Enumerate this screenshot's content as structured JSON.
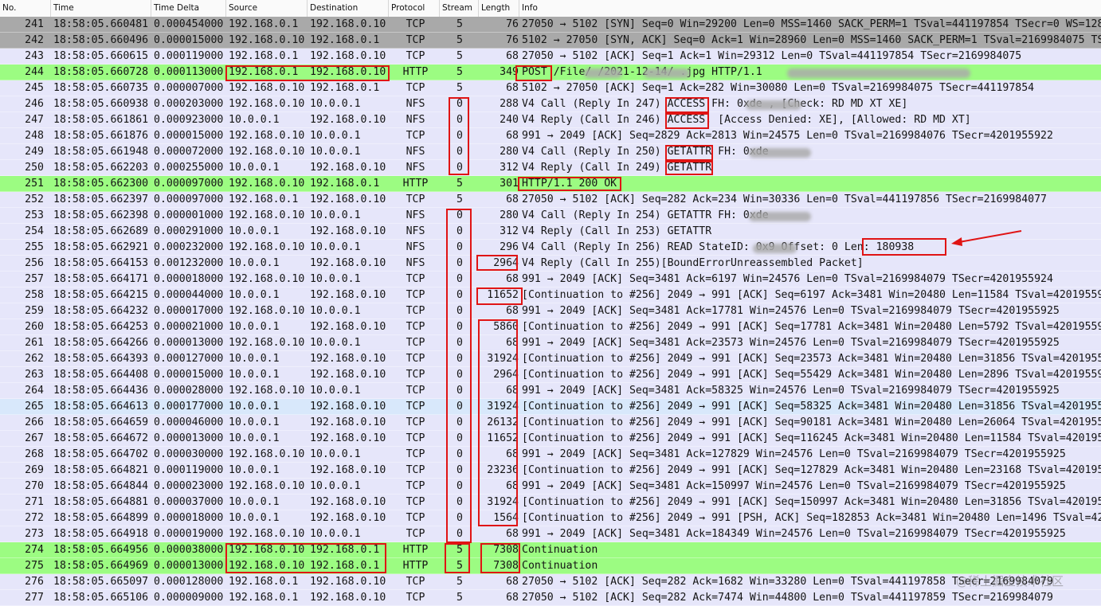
{
  "columns": {
    "no": "No.",
    "time": "Time",
    "delta": "Time Delta",
    "src": "Source",
    "dst": "Destination",
    "proto": "Protocol",
    "stream": "Stream",
    "len": "Length",
    "info": "Info"
  },
  "colors": {
    "dark": "#a9a9a9",
    "tcp": "#e6e6fa",
    "http": "#9cfc82",
    "selected": "#d8e8fb",
    "annotation": "#e01414"
  },
  "rows": [
    {
      "no": "241",
      "time": "18:58:05.660481",
      "delta": "0.000454000",
      "src": "192.168.0.1",
      "dst": "192.168.0.10",
      "proto": "TCP",
      "stream": "5",
      "len": "76",
      "info": "27050 → 5102 [SYN] Seq=0 Win=29200 Len=0 MSS=1460 SACK_PERM=1 TSval=441197854 TSecr=0 WS=128",
      "kind": "dark"
    },
    {
      "no": "242",
      "time": "18:58:05.660496",
      "delta": "0.000015000",
      "src": "192.168.0.10",
      "dst": "192.168.0.1",
      "proto": "TCP",
      "stream": "5",
      "len": "76",
      "info": "5102 → 27050 [SYN, ACK] Seq=0 Ack=1 Win=28960 Len=0 MSS=1460 SACK_PERM=1 TSval=2169984075 TSecr=441197854",
      "kind": "dark"
    },
    {
      "no": "243",
      "time": "18:58:05.660615",
      "delta": "0.000119000",
      "src": "192.168.0.1",
      "dst": "192.168.0.10",
      "proto": "TCP",
      "stream": "5",
      "len": "68",
      "info": "27050 → 5102 [ACK] Seq=1 Ack=1 Win=29312 Len=0 TSval=441197854 TSecr=2169984075",
      "kind": "tcp"
    },
    {
      "no": "244",
      "time": "18:58:05.660728",
      "delta": "0.000113000",
      "src": "192.168.0.1",
      "dst": "192.168.0.10",
      "proto": "HTTP",
      "stream": "5",
      "len": "349",
      "info": "POST /File/          /2021-12-14/                          .jpg HTTP/1.1",
      "kind": "http"
    },
    {
      "no": "245",
      "time": "18:58:05.660735",
      "delta": "0.000007000",
      "src": "192.168.0.10",
      "dst": "192.168.0.1",
      "proto": "TCP",
      "stream": "5",
      "len": "68",
      "info": "5102 → 27050 [ACK] Seq=1 Ack=282 Win=30080 Len=0 TSval=2169984075 TSecr=441197854",
      "kind": "tcp"
    },
    {
      "no": "246",
      "time": "18:58:05.660938",
      "delta": "0.000203000",
      "src": "192.168.0.10",
      "dst": "10.0.0.1",
      "proto": "NFS",
      "stream": "0",
      "len": "288",
      "info": "V4 Call (Reply In 247) ACCESS FH: 0xde       , [Check: RD MD XT XE]",
      "kind": "tcp"
    },
    {
      "no": "247",
      "time": "18:58:05.661861",
      "delta": "0.000923000",
      "src": "10.0.0.1",
      "dst": "192.168.0.10",
      "proto": "NFS",
      "stream": "0",
      "len": "240",
      "info": "V4 Reply (Call In 246) ACCESS, [Access Denied: XE], [Allowed: RD MD XT]",
      "kind": "tcp"
    },
    {
      "no": "248",
      "time": "18:58:05.661876",
      "delta": "0.000015000",
      "src": "192.168.0.10",
      "dst": "10.0.0.1",
      "proto": "TCP",
      "stream": "0",
      "len": "68",
      "info": "991 → 2049 [ACK] Seq=2829 Ack=2813 Win=24575 Len=0 TSval=2169984076 TSecr=4201955922",
      "kind": "tcp"
    },
    {
      "no": "249",
      "time": "18:58:05.661948",
      "delta": "0.000072000",
      "src": "192.168.0.10",
      "dst": "10.0.0.1",
      "proto": "NFS",
      "stream": "0",
      "len": "280",
      "info": "V4 Call (Reply In 250) GETATTR FH: 0xde",
      "kind": "tcp"
    },
    {
      "no": "250",
      "time": "18:58:05.662203",
      "delta": "0.000255000",
      "src": "10.0.0.1",
      "dst": "192.168.0.10",
      "proto": "NFS",
      "stream": "0",
      "len": "312",
      "info": "V4 Reply (Call In 249) GETATTR",
      "kind": "tcp"
    },
    {
      "no": "251",
      "time": "18:58:05.662300",
      "delta": "0.000097000",
      "src": "192.168.0.10",
      "dst": "192.168.0.1",
      "proto": "HTTP",
      "stream": "5",
      "len": "301",
      "info": "HTTP/1.1 200 OK",
      "kind": "http"
    },
    {
      "no": "252",
      "time": "18:58:05.662397",
      "delta": "0.000097000",
      "src": "192.168.0.1",
      "dst": "192.168.0.10",
      "proto": "TCP",
      "stream": "5",
      "len": "68",
      "info": "27050 → 5102 [ACK] Seq=282 Ack=234 Win=30336 Len=0 TSval=441197856 TSecr=2169984077",
      "kind": "tcp"
    },
    {
      "no": "253",
      "time": "18:58:05.662398",
      "delta": "0.000001000",
      "src": "192.168.0.10",
      "dst": "10.0.0.1",
      "proto": "NFS",
      "stream": "0",
      "len": "280",
      "info": "V4 Call (Reply In 254) GETATTR FH: 0xde",
      "kind": "tcp"
    },
    {
      "no": "254",
      "time": "18:58:05.662689",
      "delta": "0.000291000",
      "src": "10.0.0.1",
      "dst": "192.168.0.10",
      "proto": "NFS",
      "stream": "0",
      "len": "312",
      "info": "V4 Reply (Call In 253) GETATTR",
      "kind": "tcp"
    },
    {
      "no": "255",
      "time": "18:58:05.662921",
      "delta": "0.000232000",
      "src": "192.168.0.10",
      "dst": "10.0.0.1",
      "proto": "NFS",
      "stream": "0",
      "len": "296",
      "info": "V4 Call (Reply In 256) READ StateID: 0x9     Offset: 0 Len: 180938",
      "kind": "tcp"
    },
    {
      "no": "256",
      "time": "18:58:05.664153",
      "delta": "0.001232000",
      "src": "10.0.0.1",
      "dst": "192.168.0.10",
      "proto": "NFS",
      "stream": "0",
      "len": "2964",
      "info": "V4 Reply (Call In 255)[BoundErrorUnreassembled Packet]",
      "kind": "tcp"
    },
    {
      "no": "257",
      "time": "18:58:05.664171",
      "delta": "0.000018000",
      "src": "192.168.0.10",
      "dst": "10.0.0.1",
      "proto": "TCP",
      "stream": "0",
      "len": "68",
      "info": "991 → 2049 [ACK] Seq=3481 Ack=6197 Win=24576 Len=0 TSval=2169984079 TSecr=4201955924",
      "kind": "tcp"
    },
    {
      "no": "258",
      "time": "18:58:05.664215",
      "delta": "0.000044000",
      "src": "10.0.0.1",
      "dst": "192.168.0.10",
      "proto": "TCP",
      "stream": "0",
      "len": "11652",
      "info": "[Continuation to #256] 2049 → 991 [ACK] Seq=6197 Ack=3481 Win=20480 Len=11584 TSval=4201955924",
      "kind": "tcp"
    },
    {
      "no": "259",
      "time": "18:58:05.664232",
      "delta": "0.000017000",
      "src": "192.168.0.10",
      "dst": "10.0.0.1",
      "proto": "TCP",
      "stream": "0",
      "len": "68",
      "info": "991 → 2049 [ACK] Seq=3481 Ack=17781 Win=24576 Len=0 TSval=2169984079 TSecr=4201955925",
      "kind": "tcp"
    },
    {
      "no": "260",
      "time": "18:58:05.664253",
      "delta": "0.000021000",
      "src": "10.0.0.1",
      "dst": "192.168.0.10",
      "proto": "TCP",
      "stream": "0",
      "len": "5860",
      "info": "[Continuation to #256] 2049 → 991 [ACK] Seq=17781 Ack=3481 Win=20480 Len=5792 TSval=4201955925",
      "kind": "tcp"
    },
    {
      "no": "261",
      "time": "18:58:05.664266",
      "delta": "0.000013000",
      "src": "192.168.0.10",
      "dst": "10.0.0.1",
      "proto": "TCP",
      "stream": "0",
      "len": "68",
      "info": "991 → 2049 [ACK] Seq=3481 Ack=23573 Win=24576 Len=0 TSval=2169984079 TSecr=4201955925",
      "kind": "tcp"
    },
    {
      "no": "262",
      "time": "18:58:05.664393",
      "delta": "0.000127000",
      "src": "10.0.0.1",
      "dst": "192.168.0.10",
      "proto": "TCP",
      "stream": "0",
      "len": "31924",
      "info": "[Continuation to #256] 2049 → 991 [ACK] Seq=23573 Ack=3481 Win=20480 Len=31856 TSval=4201955925",
      "kind": "tcp"
    },
    {
      "no": "263",
      "time": "18:58:05.664408",
      "delta": "0.000015000",
      "src": "10.0.0.1",
      "dst": "192.168.0.10",
      "proto": "TCP",
      "stream": "0",
      "len": "2964",
      "info": "[Continuation to #256] 2049 → 991 [ACK] Seq=55429 Ack=3481 Win=20480 Len=2896 TSval=4201955925",
      "kind": "tcp"
    },
    {
      "no": "264",
      "time": "18:58:05.664436",
      "delta": "0.000028000",
      "src": "192.168.0.10",
      "dst": "10.0.0.1",
      "proto": "TCP",
      "stream": "0",
      "len": "68",
      "info": "991 → 2049 [ACK] Seq=3481 Ack=58325 Win=24576 Len=0 TSval=2169984079 TSecr=4201955925",
      "kind": "tcp"
    },
    {
      "no": "265",
      "time": "18:58:05.664613",
      "delta": "0.000177000",
      "src": "10.0.0.1",
      "dst": "192.168.0.10",
      "proto": "TCP",
      "stream": "0",
      "len": "31924",
      "info": "[Continuation to #256] 2049 → 991 [ACK] Seq=58325 Ack=3481 Win=20480 Len=31856 TSval=4201955925",
      "kind": "selected"
    },
    {
      "no": "266",
      "time": "18:58:05.664659",
      "delta": "0.000046000",
      "src": "10.0.0.1",
      "dst": "192.168.0.10",
      "proto": "TCP",
      "stream": "0",
      "len": "26132",
      "info": "[Continuation to #256] 2049 → 991 [ACK] Seq=90181 Ack=3481 Win=20480 Len=26064 TSval=4201955925",
      "kind": "tcp"
    },
    {
      "no": "267",
      "time": "18:58:05.664672",
      "delta": "0.000013000",
      "src": "10.0.0.1",
      "dst": "192.168.0.10",
      "proto": "TCP",
      "stream": "0",
      "len": "11652",
      "info": "[Continuation to #256] 2049 → 991 [ACK] Seq=116245 Ack=3481 Win=20480 Len=11584 TSval=4201955925",
      "kind": "tcp"
    },
    {
      "no": "268",
      "time": "18:58:05.664702",
      "delta": "0.000030000",
      "src": "192.168.0.10",
      "dst": "10.0.0.1",
      "proto": "TCP",
      "stream": "0",
      "len": "68",
      "info": "991 → 2049 [ACK] Seq=3481 Ack=127829 Win=24576 Len=0 TSval=2169984079 TSecr=4201955925",
      "kind": "tcp"
    },
    {
      "no": "269",
      "time": "18:58:05.664821",
      "delta": "0.000119000",
      "src": "10.0.0.1",
      "dst": "192.168.0.10",
      "proto": "TCP",
      "stream": "0",
      "len": "23236",
      "info": "[Continuation to #256] 2049 → 991 [ACK] Seq=127829 Ack=3481 Win=20480 Len=23168 TSval=4201955925",
      "kind": "tcp"
    },
    {
      "no": "270",
      "time": "18:58:05.664844",
      "delta": "0.000023000",
      "src": "192.168.0.10",
      "dst": "10.0.0.1",
      "proto": "TCP",
      "stream": "0",
      "len": "68",
      "info": "991 → 2049 [ACK] Seq=3481 Ack=150997 Win=24576 Len=0 TSval=2169984079 TSecr=4201955925",
      "kind": "tcp"
    },
    {
      "no": "271",
      "time": "18:58:05.664881",
      "delta": "0.000037000",
      "src": "10.0.0.1",
      "dst": "192.168.0.10",
      "proto": "TCP",
      "stream": "0",
      "len": "31924",
      "info": "[Continuation to #256] 2049 → 991 [ACK] Seq=150997 Ack=3481 Win=20480 Len=31856 TSval=4201955925",
      "kind": "tcp"
    },
    {
      "no": "272",
      "time": "18:58:05.664899",
      "delta": "0.000018000",
      "src": "10.0.0.1",
      "dst": "192.168.0.10",
      "proto": "TCP",
      "stream": "0",
      "len": "1564",
      "info": "[Continuation to #256] 2049 → 991 [PSH, ACK] Seq=182853 Ack=3481 Win=20480 Len=1496 TSval=4201955925",
      "kind": "tcp"
    },
    {
      "no": "273",
      "time": "18:58:05.664918",
      "delta": "0.000019000",
      "src": "192.168.0.10",
      "dst": "10.0.0.1",
      "proto": "TCP",
      "stream": "0",
      "len": "68",
      "info": "991 → 2049 [ACK] Seq=3481 Ack=184349 Win=24576 Len=0 TSval=2169984079 TSecr=4201955925",
      "kind": "tcp"
    },
    {
      "no": "274",
      "time": "18:58:05.664956",
      "delta": "0.000038000",
      "src": "192.168.0.10",
      "dst": "192.168.0.1",
      "proto": "HTTP",
      "stream": "5",
      "len": "7308",
      "info": "Continuation",
      "kind": "http"
    },
    {
      "no": "275",
      "time": "18:58:05.664969",
      "delta": "0.000013000",
      "src": "192.168.0.10",
      "dst": "192.168.0.1",
      "proto": "HTTP",
      "stream": "5",
      "len": "7308",
      "info": "Continuation",
      "kind": "http"
    },
    {
      "no": "276",
      "time": "18:58:05.665097",
      "delta": "0.000128000",
      "src": "192.168.0.1",
      "dst": "192.168.0.10",
      "proto": "TCP",
      "stream": "5",
      "len": "68",
      "info": "27050 → 5102 [ACK] Seq=282 Ack=1682 Win=33280 Len=0 TSval=441197858 TSecr=2169984079",
      "kind": "tcp"
    },
    {
      "no": "277",
      "time": "18:58:05.665106",
      "delta": "0.000009000",
      "src": "192.168.0.1",
      "dst": "192.168.0.10",
      "proto": "TCP",
      "stream": "5",
      "len": "68",
      "info": "27050 → 5102 [ACK] Seq=282 Ack=7474 Win=44800 Len=0 TSval=441197859 TSecr=2169984079",
      "kind": "tcp"
    }
  ],
  "watermark": "@稀土掘金技术社区"
}
